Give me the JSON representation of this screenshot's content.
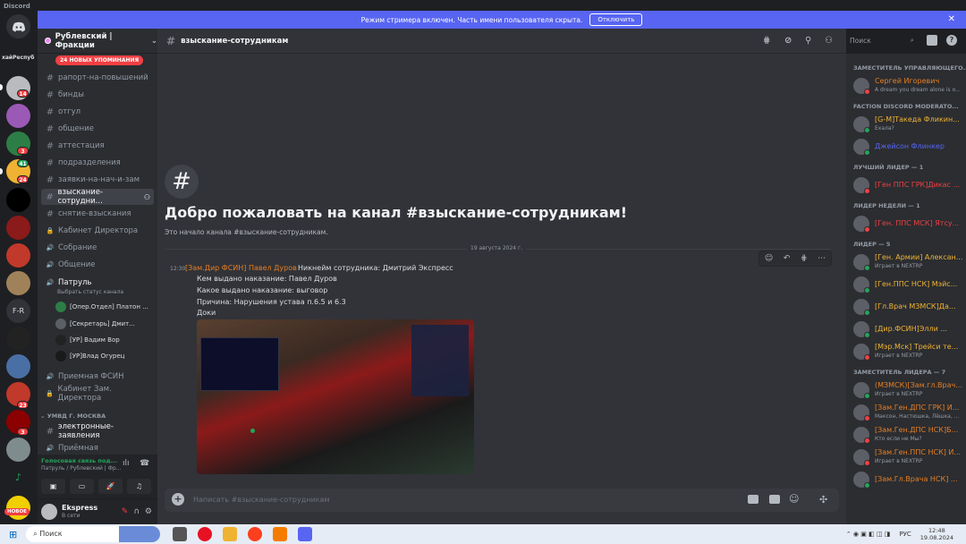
{
  "titlebar": {
    "app": "Discord"
  },
  "banner": {
    "text": "Режим стримера включен. Часть имени пользователя скрыта.",
    "button": "Отключить"
  },
  "guilds": {
    "label": "хайРеспуб",
    "badges": [
      "14",
      "3",
      "41",
      "24",
      "23",
      "3"
    ],
    "fr": "F-R",
    "new_label": "НОВОЕ"
  },
  "server": {
    "name": "Рублевский | Фракции",
    "mentions": "24 НОВЫХ УПОМИНАНИЯ"
  },
  "channels": [
    {
      "icon": "#",
      "name": "рапорт-на-повышений"
    },
    {
      "icon": "#",
      "name": "бинды"
    },
    {
      "icon": "#",
      "name": "отгул"
    },
    {
      "icon": "#",
      "name": "общение"
    },
    {
      "icon": "#",
      "name": "аттестация"
    },
    {
      "icon": "#",
      "name": "подразделения"
    },
    {
      "icon": "#",
      "name": "заявки-на-нач-и-зам"
    },
    {
      "icon": "#",
      "name": "взыскание-сотрудни..."
    },
    {
      "icon": "#",
      "name": "снятие-взыскания"
    },
    {
      "icon": "🔒",
      "name": "Кабинет Директора"
    },
    {
      "icon": "🔊",
      "name": "Собрание"
    },
    {
      "icon": "🔊",
      "name": "Общение"
    },
    {
      "icon": "🔊",
      "name": "Патруль"
    },
    {
      "icon": "🔊",
      "name": "Приемная ФСИН"
    },
    {
      "icon": "🔒",
      "name": "Кабинет Зам. Директора"
    }
  ],
  "patrol_status": "Выбрать статус канала",
  "voice_users": [
    "[Опер.Отдел] Платон ...",
    "[Секретарь] Дмит...",
    "[УР] Вадим Вор",
    "[УР]Влад Огурец"
  ],
  "category2": "УМВД Г. МОСКВА",
  "channels2": [
    {
      "icon": "#",
      "name": "электронные-заявления"
    },
    {
      "icon": "🔊",
      "name": "Приёмная"
    }
  ],
  "voice": {
    "status": "Голосовая связь под...",
    "sub": "Патруль / Рублевский | Фр..."
  },
  "user": {
    "name": "Ekspress",
    "status": "В сети"
  },
  "header": {
    "channel": "взыскание-сотрудникам",
    "search": "Поиск"
  },
  "welcome": {
    "title": "Добро пожаловать на канал #взыскание-сотрудникам!",
    "sub": "Это начало канала #взыскание-сотрудникам."
  },
  "divider": "19 августа 2024 г.",
  "message": {
    "time": "12:30",
    "author": "[Зам.Дир ФСИН] Павел Дуров",
    "lines": [
      "Никнейм сотрудника: Дмитрий Экспресс",
      "Кем выдано наказание: Павел Дуров",
      "Какое выдано наказание: выговор",
      "Причина:  Нарушения устава п.6.5 и 6.3",
      "Доки"
    ]
  },
  "input": {
    "placeholder": "Написать #взыскание-сотрудникам"
  },
  "members": [
    {
      "type": "cat",
      "text": "ЗАМЕСТИТЕЛЬ УПРАВЛЯЮЩЕГО..."
    },
    {
      "type": "mem",
      "name": "Сергей Игоревич",
      "sub": "A dream you dream alone is o...",
      "color": "#e67e22",
      "st": "#f23f43"
    },
    {
      "type": "cat",
      "text": "FACTION DISCORD MODERATO..."
    },
    {
      "type": "mem",
      "name": "[G-M]Такеда Фликин...",
      "sub": "Ехала?",
      "color": "#f0b232",
      "st": "#23a55a"
    },
    {
      "type": "mem",
      "name": "Джейсон Флинкер",
      "sub": "",
      "color": "#5865f2",
      "st": "#23a55a"
    },
    {
      "type": "cat",
      "text": "ЛУЧШИЙ ЛИДЕР — 1"
    },
    {
      "type": "mem",
      "name": "[Ген ППС ГРК]Дикас ...",
      "sub": "",
      "color": "#f23f43",
      "st": "#f23f43"
    },
    {
      "type": "cat",
      "text": "ЛИДЕР НЕДЕЛИ — 1"
    },
    {
      "type": "mem",
      "name": "[Ген. ППС МСК] Ятсу...",
      "sub": "",
      "color": "#f23f43",
      "st": "#f23f43"
    },
    {
      "type": "cat",
      "text": "ЛИДЕР — 5"
    },
    {
      "type": "mem",
      "name": "[Ген. Армии] Алексан...",
      "sub": "Играет в NEXTRP",
      "color": "#f0b232",
      "st": "#23a55a"
    },
    {
      "type": "mem",
      "name": "[Ген.ППС НСК] Мэйс...",
      "sub": "",
      "color": "#f0b232",
      "st": "#23a55a"
    },
    {
      "type": "mem",
      "name": "[Гл.Врач МЗМСК]Да...",
      "sub": "",
      "color": "#f0b232",
      "st": "#23a55a"
    },
    {
      "type": "mem",
      "name": "[Дир.ФСИН]Элли ...",
      "sub": "",
      "color": "#f0b232",
      "st": "#23a55a"
    },
    {
      "type": "mem",
      "name": "[Мэр.Мск] Трейси те...",
      "sub": "Играет в NEXTRP",
      "color": "#f0b232",
      "st": "#f23f43"
    },
    {
      "type": "cat",
      "text": "ЗАМЕСТИТЕЛЬ ЛИДЕРА — 7"
    },
    {
      "type": "mem",
      "name": "(МЗМСК)[Зам.гл.Врач...",
      "sub": "Играет в NEXTRP",
      "color": "#e67e22",
      "st": "#23a55a"
    },
    {
      "type": "mem",
      "name": "[Зам.Ген.ДПС ГРК] И...",
      "sub": "Максон, Настюшка, Лёшка, ...",
      "color": "#e67e22",
      "st": "#f23f43"
    },
    {
      "type": "mem",
      "name": "[Зам.Ген.ДПС НСК]Б...",
      "sub": "Кто если не Мы?",
      "color": "#e67e22",
      "st": "#f23f43"
    },
    {
      "type": "mem",
      "name": "[Зам.Ген.ППС НСК] И...",
      "sub": "Играет в NEXTRP",
      "color": "#e67e22",
      "st": "#f23f43"
    },
    {
      "type": "mem",
      "name": "[Зам.Гл.Врача НСК] ...",
      "sub": "",
      "color": "#e67e22",
      "st": "#23a55a"
    }
  ],
  "taskbar": {
    "search": "Поиск",
    "lang": "РУС",
    "time": "12:48",
    "date": "19.08.2024"
  }
}
